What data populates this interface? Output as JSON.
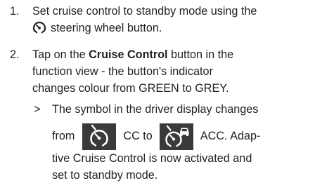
{
  "steps": [
    {
      "number": "1.",
      "text_before": "Set cruise control to standby mode using the",
      "text_after": "steering wheel button.",
      "icon": "steering-wheel-cruise-icon"
    },
    {
      "number": "2.",
      "line1_before": "Tap on the",
      "line1_bold": "Cruise Control",
      "line1_after": "button in the",
      "line2": "function view - the button's indicator",
      "line3": "changes colour from GREEN to GREY.",
      "result": {
        "marker": ">",
        "line1": "The symbol in the driver display changes",
        "from_word": "from",
        "cc_label": "CC to",
        "acc_label": "ACC. Adap-",
        "line3": "tive Cruise Control is now activated and",
        "line4": "set to standby mode.",
        "cc_icon": "cruise-control-symbol-icon",
        "acc_icon": "adaptive-cruise-control-symbol-icon"
      }
    }
  ],
  "colors": {
    "text": "#222222",
    "symbol_bg": "#3a3a3a",
    "symbol_fg": "#ffffff"
  }
}
